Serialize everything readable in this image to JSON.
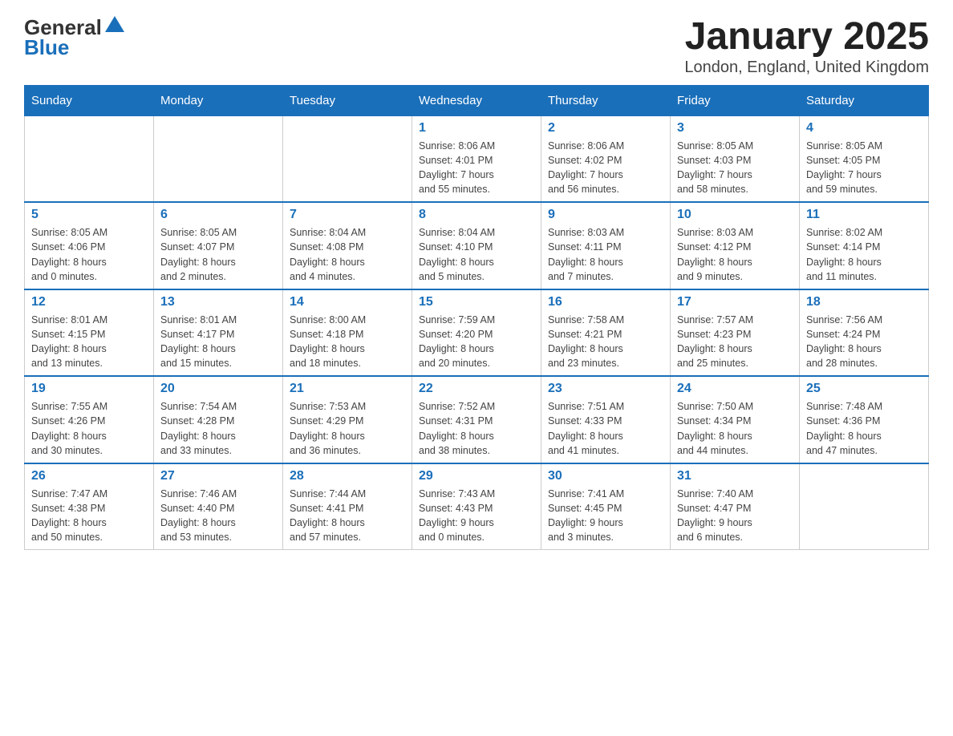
{
  "header": {
    "logo_line1": "General",
    "logo_line2": "Blue",
    "title": "January 2025",
    "subtitle": "London, England, United Kingdom"
  },
  "days_of_week": [
    "Sunday",
    "Monday",
    "Tuesday",
    "Wednesday",
    "Thursday",
    "Friday",
    "Saturday"
  ],
  "weeks": [
    [
      {
        "day": "",
        "info": ""
      },
      {
        "day": "",
        "info": ""
      },
      {
        "day": "",
        "info": ""
      },
      {
        "day": "1",
        "info": "Sunrise: 8:06 AM\nSunset: 4:01 PM\nDaylight: 7 hours\nand 55 minutes."
      },
      {
        "day": "2",
        "info": "Sunrise: 8:06 AM\nSunset: 4:02 PM\nDaylight: 7 hours\nand 56 minutes."
      },
      {
        "day": "3",
        "info": "Sunrise: 8:05 AM\nSunset: 4:03 PM\nDaylight: 7 hours\nand 58 minutes."
      },
      {
        "day": "4",
        "info": "Sunrise: 8:05 AM\nSunset: 4:05 PM\nDaylight: 7 hours\nand 59 minutes."
      }
    ],
    [
      {
        "day": "5",
        "info": "Sunrise: 8:05 AM\nSunset: 4:06 PM\nDaylight: 8 hours\nand 0 minutes."
      },
      {
        "day": "6",
        "info": "Sunrise: 8:05 AM\nSunset: 4:07 PM\nDaylight: 8 hours\nand 2 minutes."
      },
      {
        "day": "7",
        "info": "Sunrise: 8:04 AM\nSunset: 4:08 PM\nDaylight: 8 hours\nand 4 minutes."
      },
      {
        "day": "8",
        "info": "Sunrise: 8:04 AM\nSunset: 4:10 PM\nDaylight: 8 hours\nand 5 minutes."
      },
      {
        "day": "9",
        "info": "Sunrise: 8:03 AM\nSunset: 4:11 PM\nDaylight: 8 hours\nand 7 minutes."
      },
      {
        "day": "10",
        "info": "Sunrise: 8:03 AM\nSunset: 4:12 PM\nDaylight: 8 hours\nand 9 minutes."
      },
      {
        "day": "11",
        "info": "Sunrise: 8:02 AM\nSunset: 4:14 PM\nDaylight: 8 hours\nand 11 minutes."
      }
    ],
    [
      {
        "day": "12",
        "info": "Sunrise: 8:01 AM\nSunset: 4:15 PM\nDaylight: 8 hours\nand 13 minutes."
      },
      {
        "day": "13",
        "info": "Sunrise: 8:01 AM\nSunset: 4:17 PM\nDaylight: 8 hours\nand 15 minutes."
      },
      {
        "day": "14",
        "info": "Sunrise: 8:00 AM\nSunset: 4:18 PM\nDaylight: 8 hours\nand 18 minutes."
      },
      {
        "day": "15",
        "info": "Sunrise: 7:59 AM\nSunset: 4:20 PM\nDaylight: 8 hours\nand 20 minutes."
      },
      {
        "day": "16",
        "info": "Sunrise: 7:58 AM\nSunset: 4:21 PM\nDaylight: 8 hours\nand 23 minutes."
      },
      {
        "day": "17",
        "info": "Sunrise: 7:57 AM\nSunset: 4:23 PM\nDaylight: 8 hours\nand 25 minutes."
      },
      {
        "day": "18",
        "info": "Sunrise: 7:56 AM\nSunset: 4:24 PM\nDaylight: 8 hours\nand 28 minutes."
      }
    ],
    [
      {
        "day": "19",
        "info": "Sunrise: 7:55 AM\nSunset: 4:26 PM\nDaylight: 8 hours\nand 30 minutes."
      },
      {
        "day": "20",
        "info": "Sunrise: 7:54 AM\nSunset: 4:28 PM\nDaylight: 8 hours\nand 33 minutes."
      },
      {
        "day": "21",
        "info": "Sunrise: 7:53 AM\nSunset: 4:29 PM\nDaylight: 8 hours\nand 36 minutes."
      },
      {
        "day": "22",
        "info": "Sunrise: 7:52 AM\nSunset: 4:31 PM\nDaylight: 8 hours\nand 38 minutes."
      },
      {
        "day": "23",
        "info": "Sunrise: 7:51 AM\nSunset: 4:33 PM\nDaylight: 8 hours\nand 41 minutes."
      },
      {
        "day": "24",
        "info": "Sunrise: 7:50 AM\nSunset: 4:34 PM\nDaylight: 8 hours\nand 44 minutes."
      },
      {
        "day": "25",
        "info": "Sunrise: 7:48 AM\nSunset: 4:36 PM\nDaylight: 8 hours\nand 47 minutes."
      }
    ],
    [
      {
        "day": "26",
        "info": "Sunrise: 7:47 AM\nSunset: 4:38 PM\nDaylight: 8 hours\nand 50 minutes."
      },
      {
        "day": "27",
        "info": "Sunrise: 7:46 AM\nSunset: 4:40 PM\nDaylight: 8 hours\nand 53 minutes."
      },
      {
        "day": "28",
        "info": "Sunrise: 7:44 AM\nSunset: 4:41 PM\nDaylight: 8 hours\nand 57 minutes."
      },
      {
        "day": "29",
        "info": "Sunrise: 7:43 AM\nSunset: 4:43 PM\nDaylight: 9 hours\nand 0 minutes."
      },
      {
        "day": "30",
        "info": "Sunrise: 7:41 AM\nSunset: 4:45 PM\nDaylight: 9 hours\nand 3 minutes."
      },
      {
        "day": "31",
        "info": "Sunrise: 7:40 AM\nSunset: 4:47 PM\nDaylight: 9 hours\nand 6 minutes."
      },
      {
        "day": "",
        "info": ""
      }
    ]
  ]
}
